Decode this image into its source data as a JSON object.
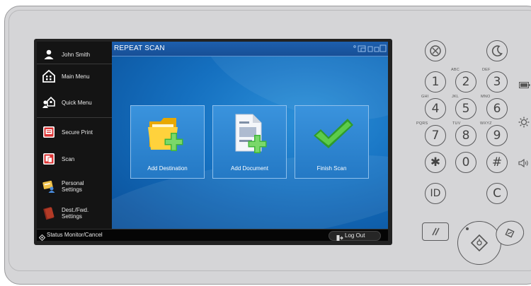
{
  "sidebar": {
    "items": [
      {
        "label": "John Smith",
        "icon": "user-icon"
      },
      {
        "label": "Main Menu",
        "icon": "main-menu-icon"
      },
      {
        "label": "Quick Menu",
        "icon": "quick-menu-icon"
      },
      {
        "label": "Secure Print",
        "icon": "secure-print-icon"
      },
      {
        "label": "Scan",
        "icon": "scan-icon"
      },
      {
        "label": "Personal\nSettings",
        "icon": "personal-settings-icon"
      },
      {
        "label": "Dest./Fwd.\nSettings",
        "icon": "dest-fwd-settings-icon"
      }
    ]
  },
  "screen": {
    "title": "REPEAT SCAN",
    "tiles": [
      {
        "label": "Add Destination",
        "icon": "add-folder-icon"
      },
      {
        "label": "Add Document",
        "icon": "add-document-icon"
      },
      {
        "label": "Finish Scan",
        "icon": "checkmark-icon"
      }
    ]
  },
  "statusbar": {
    "status_label": "Status Monitor/Cancel",
    "logout_label": "Log Out"
  },
  "keypad": {
    "keys": [
      {
        "label": "1",
        "sub": ""
      },
      {
        "label": "2",
        "sub": "ABC"
      },
      {
        "label": "3",
        "sub": "DEF"
      },
      {
        "label": "4",
        "sub": "GHI"
      },
      {
        "label": "5",
        "sub": "JKL"
      },
      {
        "label": "6",
        "sub": "MNO"
      },
      {
        "label": "7",
        "sub": "PQRS"
      },
      {
        "label": "8",
        "sub": "TUV"
      },
      {
        "label": "9",
        "sub": "WXYZ"
      },
      {
        "label": "✱",
        "sub": ""
      },
      {
        "label": "0",
        "sub": ""
      },
      {
        "label": "#",
        "sub": ""
      },
      {
        "label": "ID",
        "sub": ""
      },
      {
        "label": "C",
        "sub": ""
      }
    ]
  },
  "colors": {
    "screen_blue": "#1570c0",
    "tile_blue": "#2c83d0",
    "device_gray": "#d5d5d7",
    "check_green": "#3fb53a"
  }
}
